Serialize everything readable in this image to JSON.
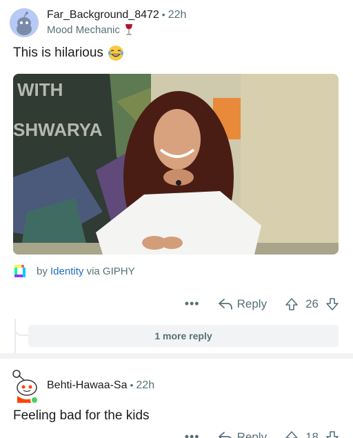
{
  "comments": [
    {
      "username": "Far_Background_8472",
      "time": "22h",
      "flair": "Mood Mechanic",
      "text": "This is hilarious",
      "gif_text_line1": "WITH",
      "gif_text_line2": "SHWARYA",
      "attribution_by": "by",
      "attribution_author": "Identity",
      "attribution_via": "via GIPHY",
      "more_label": "•••",
      "reply_label": "Reply",
      "votes": "26",
      "more_replies_label": "1 more reply"
    },
    {
      "username": "Behti-Hawaa-Sa",
      "time": "22h",
      "text": "Feeling bad for the kids",
      "more_label": "•••",
      "reply_label": "Reply",
      "votes": "18"
    }
  ],
  "colors": {
    "meta": "#576f76",
    "link": "#1d6ec4",
    "divider": "#f1f2f3"
  }
}
